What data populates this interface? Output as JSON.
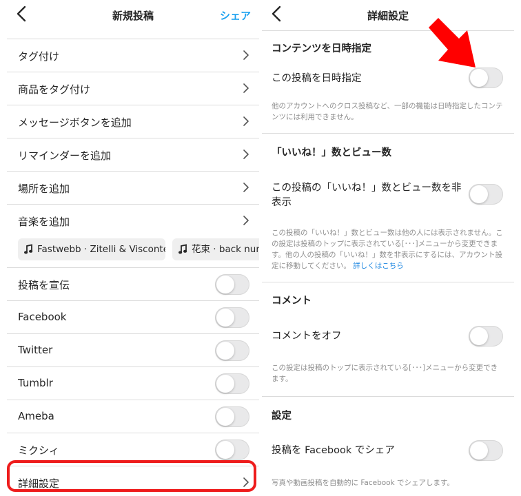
{
  "colors": {
    "accent": "#1aa1f0",
    "highlight": "#ee1c1c",
    "arrow": "#ff0000"
  },
  "left": {
    "header": {
      "title": "新規投稿",
      "action": "シェア"
    },
    "nav_items": [
      {
        "label": "タグ付け"
      },
      {
        "label": "商品をタグ付け"
      },
      {
        "label": "メッセージボタンを追加"
      },
      {
        "label": "リマインダーを追加"
      },
      {
        "label": "場所を追加"
      },
      {
        "label": "音楽を追加"
      }
    ],
    "music": [
      {
        "label": "Fastwebb · Zitelli & Visconte"
      },
      {
        "label": "花束 · back num"
      }
    ],
    "toggles": [
      {
        "label": "投稿を宣伝",
        "on": false
      },
      {
        "label": "Facebook",
        "on": false
      },
      {
        "label": "Twitter",
        "on": false
      },
      {
        "label": "Tumblr",
        "on": false
      },
      {
        "label": "Ameba",
        "on": false
      },
      {
        "label": "ミクシィ",
        "on": false
      }
    ],
    "advanced": {
      "label": "詳細設定"
    }
  },
  "right": {
    "header": {
      "title": "詳細設定"
    },
    "schedule": {
      "section": "コンテンツを日時指定",
      "label": "この投稿を日時指定",
      "desc": "他のアカウントへのクロス投稿など、一部の機能は日時指定したコンテンツには利用できません。",
      "on": false
    },
    "likes": {
      "section": "「いいね！」数とビュー数",
      "label": "この投稿の「いいね！」数とビュー数を非表示",
      "desc": "この投稿の「いいね！」数とビュー数は他の人には表示されません。この設定は投稿のトップに表示されている[･･･]メニューから変更できます。他の人の投稿の「いいね！」数を非表示にするには、アカウント設定に移動してください。",
      "link": "詳しくはこちら",
      "on": false
    },
    "comments": {
      "section": "コメント",
      "label": "コメントをオフ",
      "desc": "この設定は投稿のトップに表示されている[･･･]メニューから変更できます。",
      "on": false
    },
    "settings": {
      "section": "設定",
      "label": "投稿を Facebook でシェア",
      "desc": "写真や動画投稿を自動的に Facebook でシェアします。",
      "on": false
    }
  }
}
